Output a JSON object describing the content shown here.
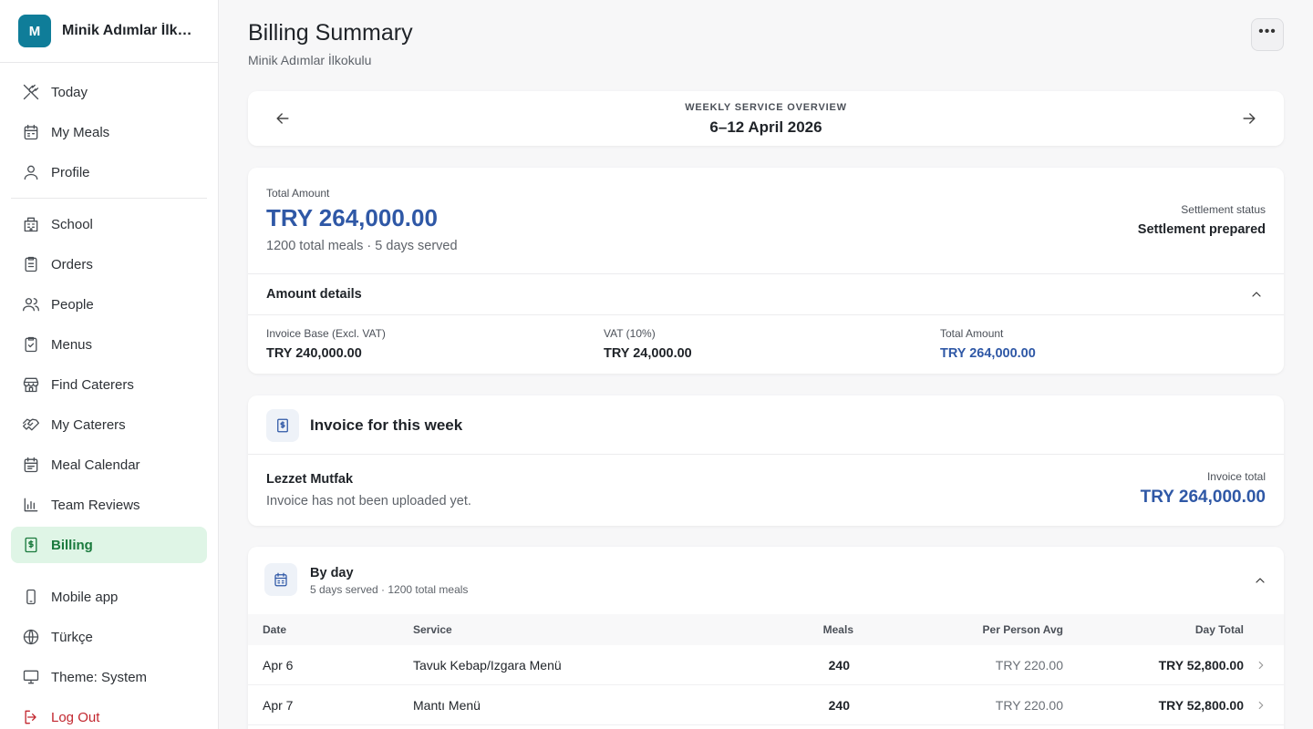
{
  "brand": {
    "initial": "M",
    "name": "Minik Adımlar İlkokulu"
  },
  "nav": {
    "group1": [
      {
        "label": "Today",
        "icon": "utensils-crossed-icon"
      },
      {
        "label": "My Meals",
        "icon": "calendar-icon"
      },
      {
        "label": "Profile",
        "icon": "user-icon"
      }
    ],
    "group2": [
      {
        "label": "School",
        "icon": "building-icon"
      },
      {
        "label": "Orders",
        "icon": "clipboard-list-icon"
      },
      {
        "label": "People",
        "icon": "users-icon"
      },
      {
        "label": "Menus",
        "icon": "clipboard-check-icon"
      },
      {
        "label": "Find Caterers",
        "icon": "store-icon"
      },
      {
        "label": "My Caterers",
        "icon": "handshake-icon"
      },
      {
        "label": "Meal Calendar",
        "icon": "calendar-days-icon"
      },
      {
        "label": "Team Reviews",
        "icon": "bar-chart-icon"
      },
      {
        "label": "Billing",
        "icon": "receipt-dollar-icon",
        "active": true
      }
    ],
    "group3": [
      {
        "label": "Mobile app",
        "icon": "smartphone-icon"
      },
      {
        "label": "Türkçe",
        "icon": "globe-icon"
      },
      {
        "label": "Theme: System",
        "icon": "monitor-icon"
      },
      {
        "label": "Log Out",
        "icon": "logout-icon"
      }
    ]
  },
  "header": {
    "title": "Billing Summary",
    "subtitle": "Minik Adımlar İlkokulu"
  },
  "week": {
    "label": "WEEKLY SERVICE OVERVIEW",
    "range": "6–12 April 2026"
  },
  "total": {
    "label": "Total Amount",
    "amount": "TRY 264,000.00",
    "summary": "1200 total meals · 5 days served",
    "status_label": "Settlement status",
    "status_value": "Settlement prepared"
  },
  "details": {
    "title": "Amount details",
    "base_label": "Invoice Base (Excl. VAT)",
    "base_value": "TRY 240,000.00",
    "vat_label": "VAT (10%)",
    "vat_value": "TRY 24,000.00",
    "total_label": "Total Amount",
    "total_value": "TRY 264,000.00"
  },
  "invoice": {
    "title": "Invoice for this week",
    "caterer": "Lezzet Mutfak",
    "status": "Invoice has not been uploaded yet.",
    "total_label": "Invoice total",
    "total_value": "TRY 264,000.00"
  },
  "byday": {
    "title": "By day",
    "subtitle": "5 days served · 1200 total meals",
    "columns": {
      "date": "Date",
      "service": "Service",
      "meals": "Meals",
      "avg": "Per Person Avg",
      "total": "Day Total"
    },
    "rows": [
      {
        "date": "Apr 6",
        "service": "Tavuk Kebap/Izgara Menü",
        "meals": "240",
        "avg": "TRY 220.00",
        "total": "TRY 52,800.00"
      },
      {
        "date": "Apr 7",
        "service": "Mantı Menü",
        "meals": "240",
        "avg": "TRY 220.00",
        "total": "TRY 52,800.00"
      }
    ]
  },
  "colors": {
    "accent": "#2f58a6",
    "brand": "#0f7d99",
    "active_bg": "#dff5e6",
    "active_text": "#1a7a3d",
    "danger": "#c2262e"
  }
}
